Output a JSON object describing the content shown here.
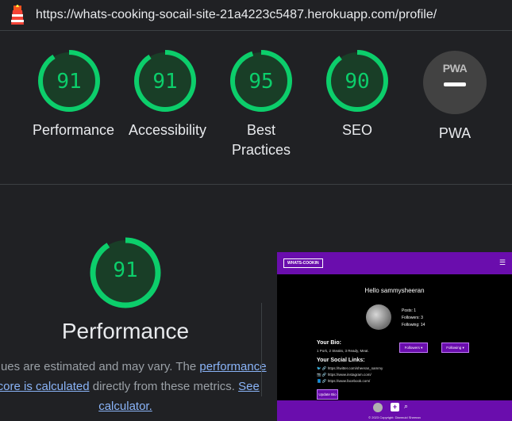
{
  "url": "https://whats-cooking-socail-site-21a4223c5487.herokuapp.com/profile/",
  "colors": {
    "pass": "#0cce6b",
    "pass_bg": "#193e27",
    "page_bg": "#202124",
    "link": "#8ab4f8",
    "thumb_brand": "#6a0dad"
  },
  "scores": [
    {
      "value": "91",
      "label": "Performance"
    },
    {
      "value": "91",
      "label": "Accessibility"
    },
    {
      "value": "95",
      "label": "Best Practices"
    },
    {
      "value": "90",
      "label": "SEO"
    }
  ],
  "pwa": {
    "badge": "PWA",
    "label": "PWA"
  },
  "performance": {
    "score": "91",
    "title": "Performance",
    "desc_1": "Values are estimated and may vary. The",
    "link_1": "performance score is calculated",
    "desc_2": "directly from these metrics.",
    "link_2": "See calculator."
  },
  "thumb": {
    "brand": "WHATS-COOKIN",
    "hello": "Hello sammysheeran",
    "posts": "Posts: 1",
    "followers_count": "Followers: 3",
    "following_count": "Following: 14",
    "bio_heading": "Your Bio:",
    "bio_text": "1 Pork, 2 Steaks, 3 Ready, Meat.",
    "followers_btn": "Followers ▾",
    "following_btn": "Following ▾",
    "links_heading": "Your Social Links:",
    "links": [
      "🐦 🔗 https://twitter.com/sheeran_sammy",
      "📷 🔗 https://www.instagram.com/",
      "📘 🔗 https://www.facebook.com/"
    ],
    "update_btn": "Update Bio",
    "copyright": "© 2023 Copyright: Diarmuid Sheeran"
  }
}
